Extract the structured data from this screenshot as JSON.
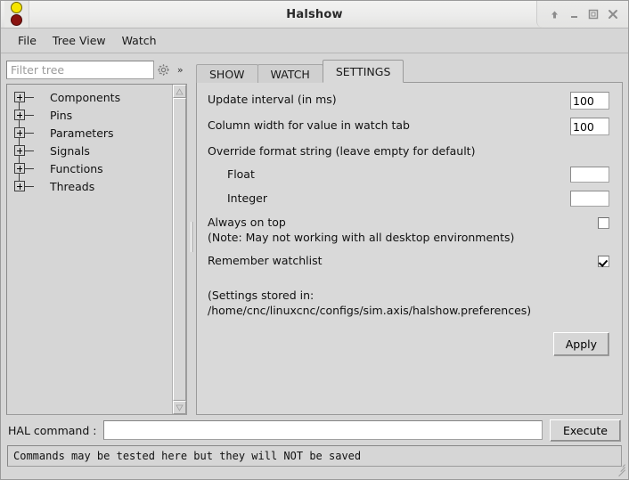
{
  "window": {
    "title": "Halshow",
    "icon_name": "halshow-led-icon",
    "controls": [
      {
        "name": "shade-button",
        "glyph": "shade"
      },
      {
        "name": "minimize-button",
        "glyph": "minimize"
      },
      {
        "name": "maximize-button",
        "glyph": "maximize"
      },
      {
        "name": "close-button",
        "glyph": "close"
      }
    ]
  },
  "menubar": {
    "items": [
      {
        "label": "File"
      },
      {
        "label": "Tree View"
      },
      {
        "label": "Watch"
      }
    ]
  },
  "left_pane": {
    "filter": {
      "placeholder": "Filter tree",
      "value": ""
    },
    "gear_icon": "gear-icon",
    "expand_icon": "»",
    "tree_items": [
      {
        "label": "Components"
      },
      {
        "label": "Pins"
      },
      {
        "label": "Parameters"
      },
      {
        "label": "Signals"
      },
      {
        "label": "Functions"
      },
      {
        "label": "Threads"
      }
    ]
  },
  "tabs": [
    {
      "label": "SHOW",
      "active": false
    },
    {
      "label": "WATCH",
      "active": false
    },
    {
      "label": "SETTINGS",
      "active": true
    }
  ],
  "settings": {
    "update_interval": {
      "label": "Update interval (in ms)",
      "value": "100"
    },
    "column_width": {
      "label": "Column width for value in watch tab",
      "value": "100"
    },
    "override_heading": "Override format string (leave empty for default)",
    "float_format": {
      "label": "Float",
      "value": ""
    },
    "integer_format": {
      "label": "Integer",
      "value": ""
    },
    "always_on_top": {
      "label": "Always on top",
      "note": "(Note: May not working with all desktop environments)",
      "checked": false
    },
    "remember_watchlist": {
      "label": "Remember watchlist",
      "checked": true
    },
    "storage_note_line1": "(Settings stored in:",
    "storage_note_line2": "/home/cnc/linuxcnc/configs/sim.axis/halshow.preferences)",
    "apply_label": "Apply"
  },
  "hal_command": {
    "label": "HAL command :",
    "value": "",
    "placeholder": "",
    "execute_label": "Execute"
  },
  "statusbar": {
    "text": "Commands may be tested here but they will NOT be saved"
  },
  "colors": {
    "window_bg": "#d6d6d6",
    "panel_bg": "#d9d9d9",
    "titlebar_top": "#f2f2f1",
    "titlebar_bottom": "#e2e2e1",
    "field_bg": "#ffffff",
    "border": "#9a9a9a",
    "led_top": "#f6e500",
    "led_bottom": "#8a1410"
  }
}
